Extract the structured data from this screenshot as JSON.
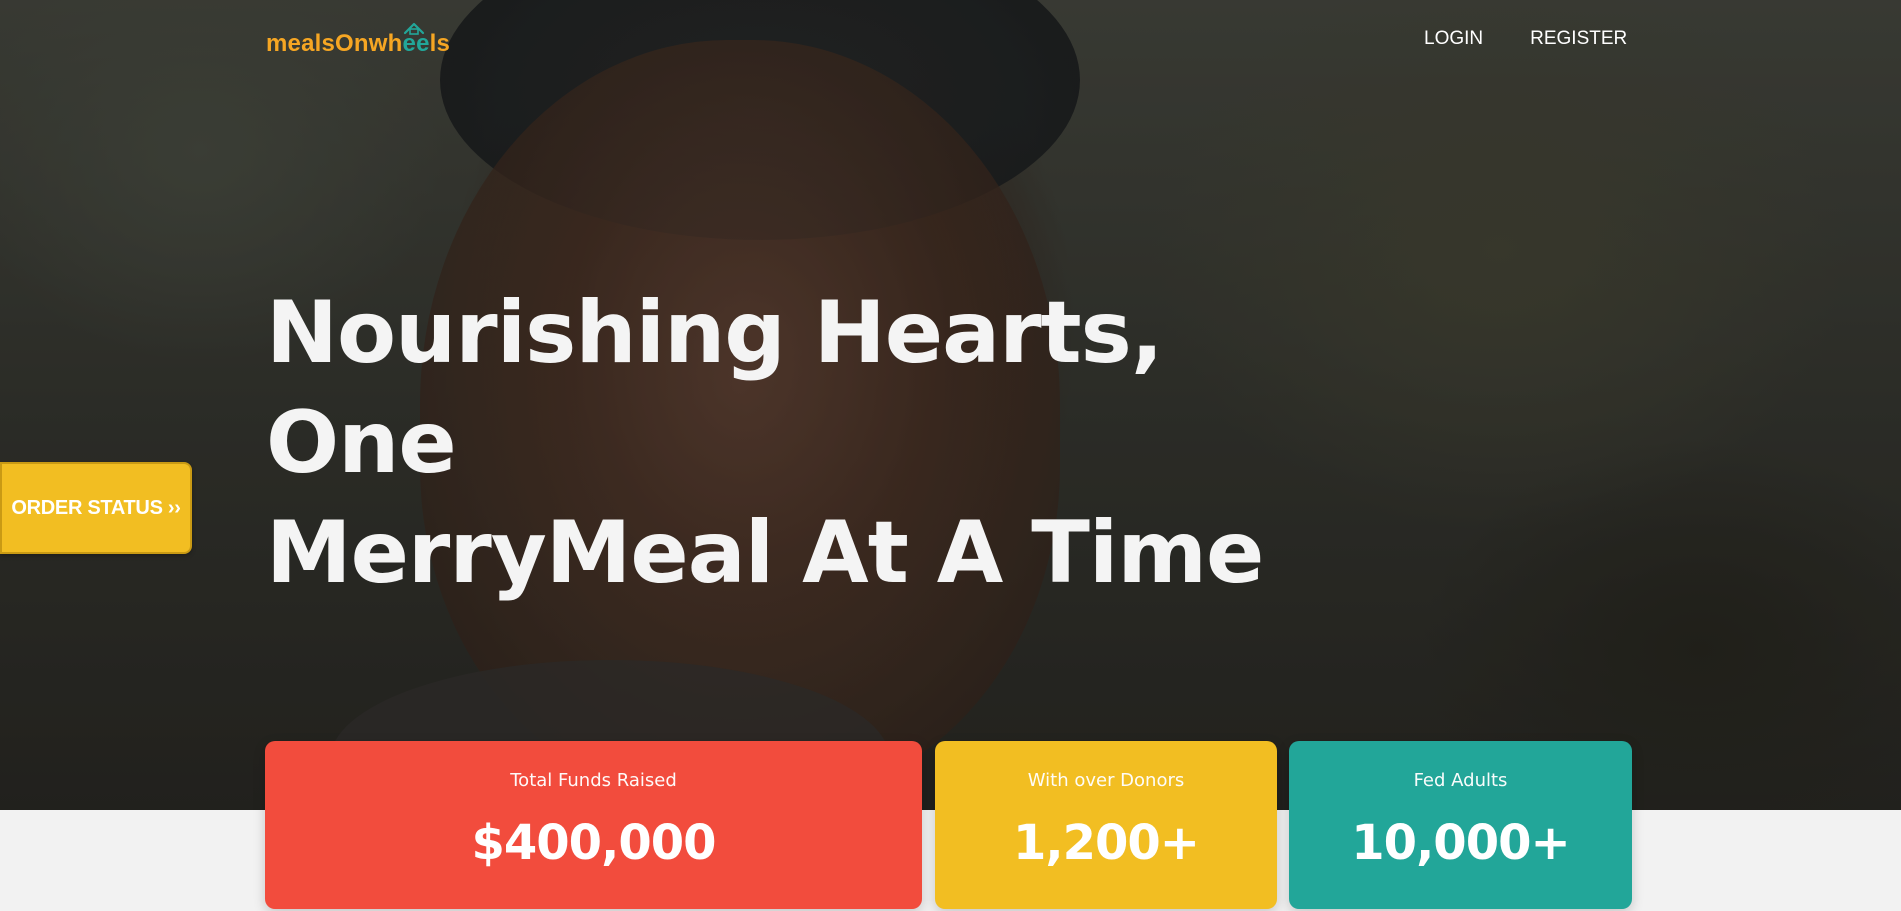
{
  "brand": {
    "logo_part1": "mealsOnwh",
    "logo_part2": "ee",
    "logo_part3": "ls",
    "primary_color": "#f6a623",
    "accent_color": "#22a699"
  },
  "nav": {
    "login_label": "LOGIN",
    "register_label": "REGISTER"
  },
  "hero": {
    "headline_line1": "Nourishing Hearts, One",
    "headline_line2": "MerryMeal At A Time"
  },
  "order_status": {
    "label": "ORDER STATUS ››",
    "color": "#f2be22"
  },
  "stats": [
    {
      "label": "Total Funds Raised",
      "value": "$400,000",
      "color": "#f24c3d"
    },
    {
      "label": "With over Donors",
      "value": "1,200+",
      "color": "#f2be22"
    },
    {
      "label": "Fed Adults",
      "value": "10,000+",
      "color": "#22a699"
    }
  ]
}
